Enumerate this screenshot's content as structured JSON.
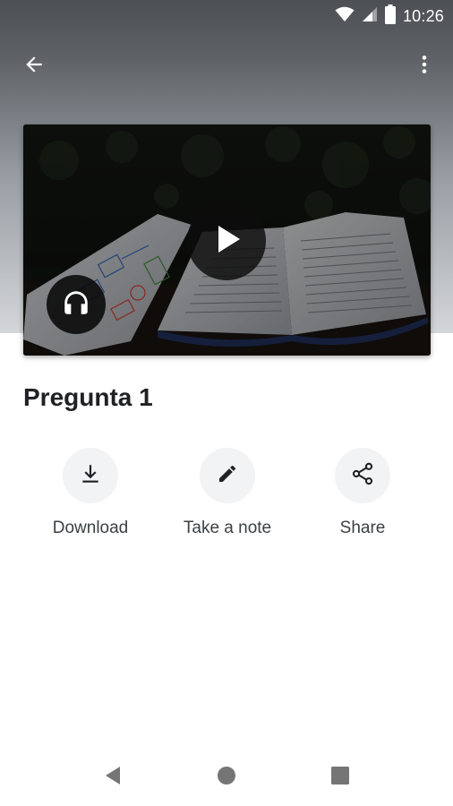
{
  "status_bar": {
    "time": "10:26",
    "icons": [
      "wifi-icon",
      "cell-signal-icon",
      "battery-icon"
    ]
  },
  "app_bar": {
    "back_icon": "arrow-back-icon",
    "menu_icon": "more-vert-icon"
  },
  "media": {
    "play_icon": "play-icon",
    "audio_icon": "headphones-icon"
  },
  "title": "Pregunta 1",
  "actions": [
    {
      "icon": "download-icon",
      "label": "Download"
    },
    {
      "icon": "pencil-icon",
      "label": "Take a note"
    },
    {
      "icon": "share-icon",
      "label": "Share"
    }
  ],
  "nav_bar": {
    "icons": [
      "nav-back-icon",
      "nav-home-icon",
      "nav-recents-icon"
    ]
  },
  "colors": {
    "header_dark": "#5f6368",
    "title_text": "#202124",
    "action_bg": "#f1f3f4",
    "action_text": "#3c4043",
    "nav_icon": "#757575"
  }
}
